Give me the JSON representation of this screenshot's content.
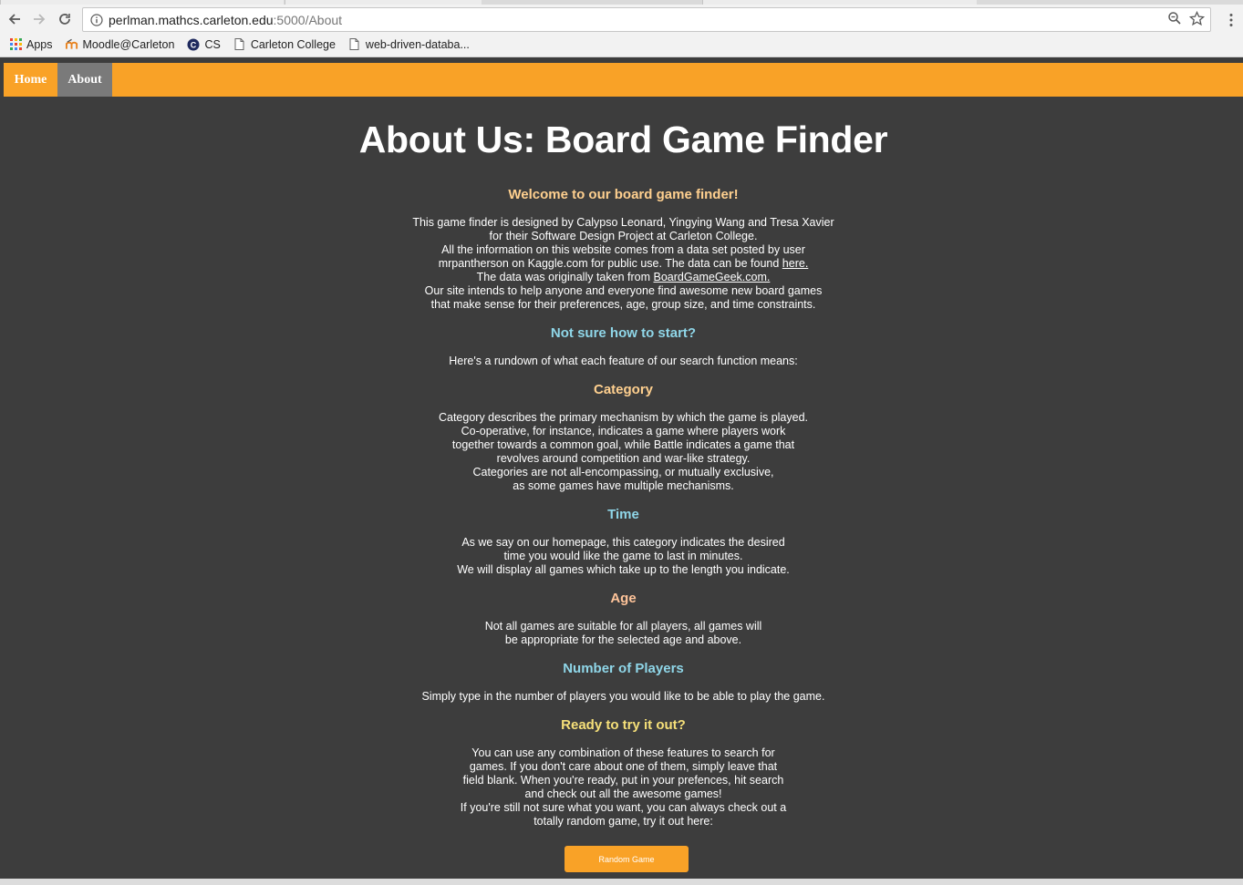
{
  "browser": {
    "url_host": "perlman.mathcs.carleton.edu",
    "url_path": ":5000/About",
    "bookmarks": [
      "Apps",
      "Moodle@Carleton",
      "CS",
      "Carleton College",
      "web-driven-databa..."
    ]
  },
  "nav": {
    "home": "Home",
    "about": "About"
  },
  "title": "About Us: Board Game Finder",
  "welcome": {
    "heading": "Welcome to our board game finder!",
    "lines": [
      "This game finder is designed by Calypso Leonard, Yingying Wang and Tresa Xavier",
      "for their Software Design Project at Carleton College.",
      "All the information on this website comes from a data set posted by user",
      "mrpantherson on Kaggle.com for public use. The data can be found",
      "here.",
      "The data was originally taken from",
      "BoardGameGeek.com.",
      "Our site intends to help anyone and everyone find awesome new board games",
      "that make sense for their preferences, age, group size, and time constraints."
    ]
  },
  "start": {
    "heading": "Not sure how to start?",
    "text": "Here's a rundown of what each feature of our search function means:"
  },
  "category": {
    "heading": "Category",
    "lines": [
      "Category describes the primary mechanism by which the game is played.",
      "Co-operative, for instance, indicates a game where players work",
      "together towards a common goal, while Battle indicates a game that",
      "revolves around competition and war-like strategy.",
      "Categories are not all-encompassing, or mutually exclusive,",
      "as some games have multiple mechanisms."
    ]
  },
  "time": {
    "heading": "Time",
    "lines": [
      "As we say on our homepage, this category indicates the desired",
      "time you would like the game to last in minutes.",
      "We will display all games which take up to the length you indicate."
    ]
  },
  "age": {
    "heading": "Age",
    "lines": [
      "Not all games are suitable for all players, all games will",
      "be appropriate for the selected age and above."
    ]
  },
  "players": {
    "heading": "Number of Players",
    "text": "Simply type in the number of players you would like to be able to play the game."
  },
  "ready": {
    "heading": "Ready to try it out?",
    "lines": [
      "You can use any combination of these features to search for",
      "games. If you don't care about one of them, simply leave that",
      "field blank. When you're ready, put in your prefences, hit search",
      "and check out all the awesome games!",
      "If you're still not sure what you want, you can always check out a",
      "totally random game, try it out here:"
    ]
  },
  "random_button": "Random Game",
  "colors": {
    "nav_bg": "#f9a227",
    "nav_active": "#7a7a7a",
    "page_bg": "#3d3d3d",
    "heading_orange": "#ffd08f",
    "heading_cyan": "#8fd6e8"
  }
}
